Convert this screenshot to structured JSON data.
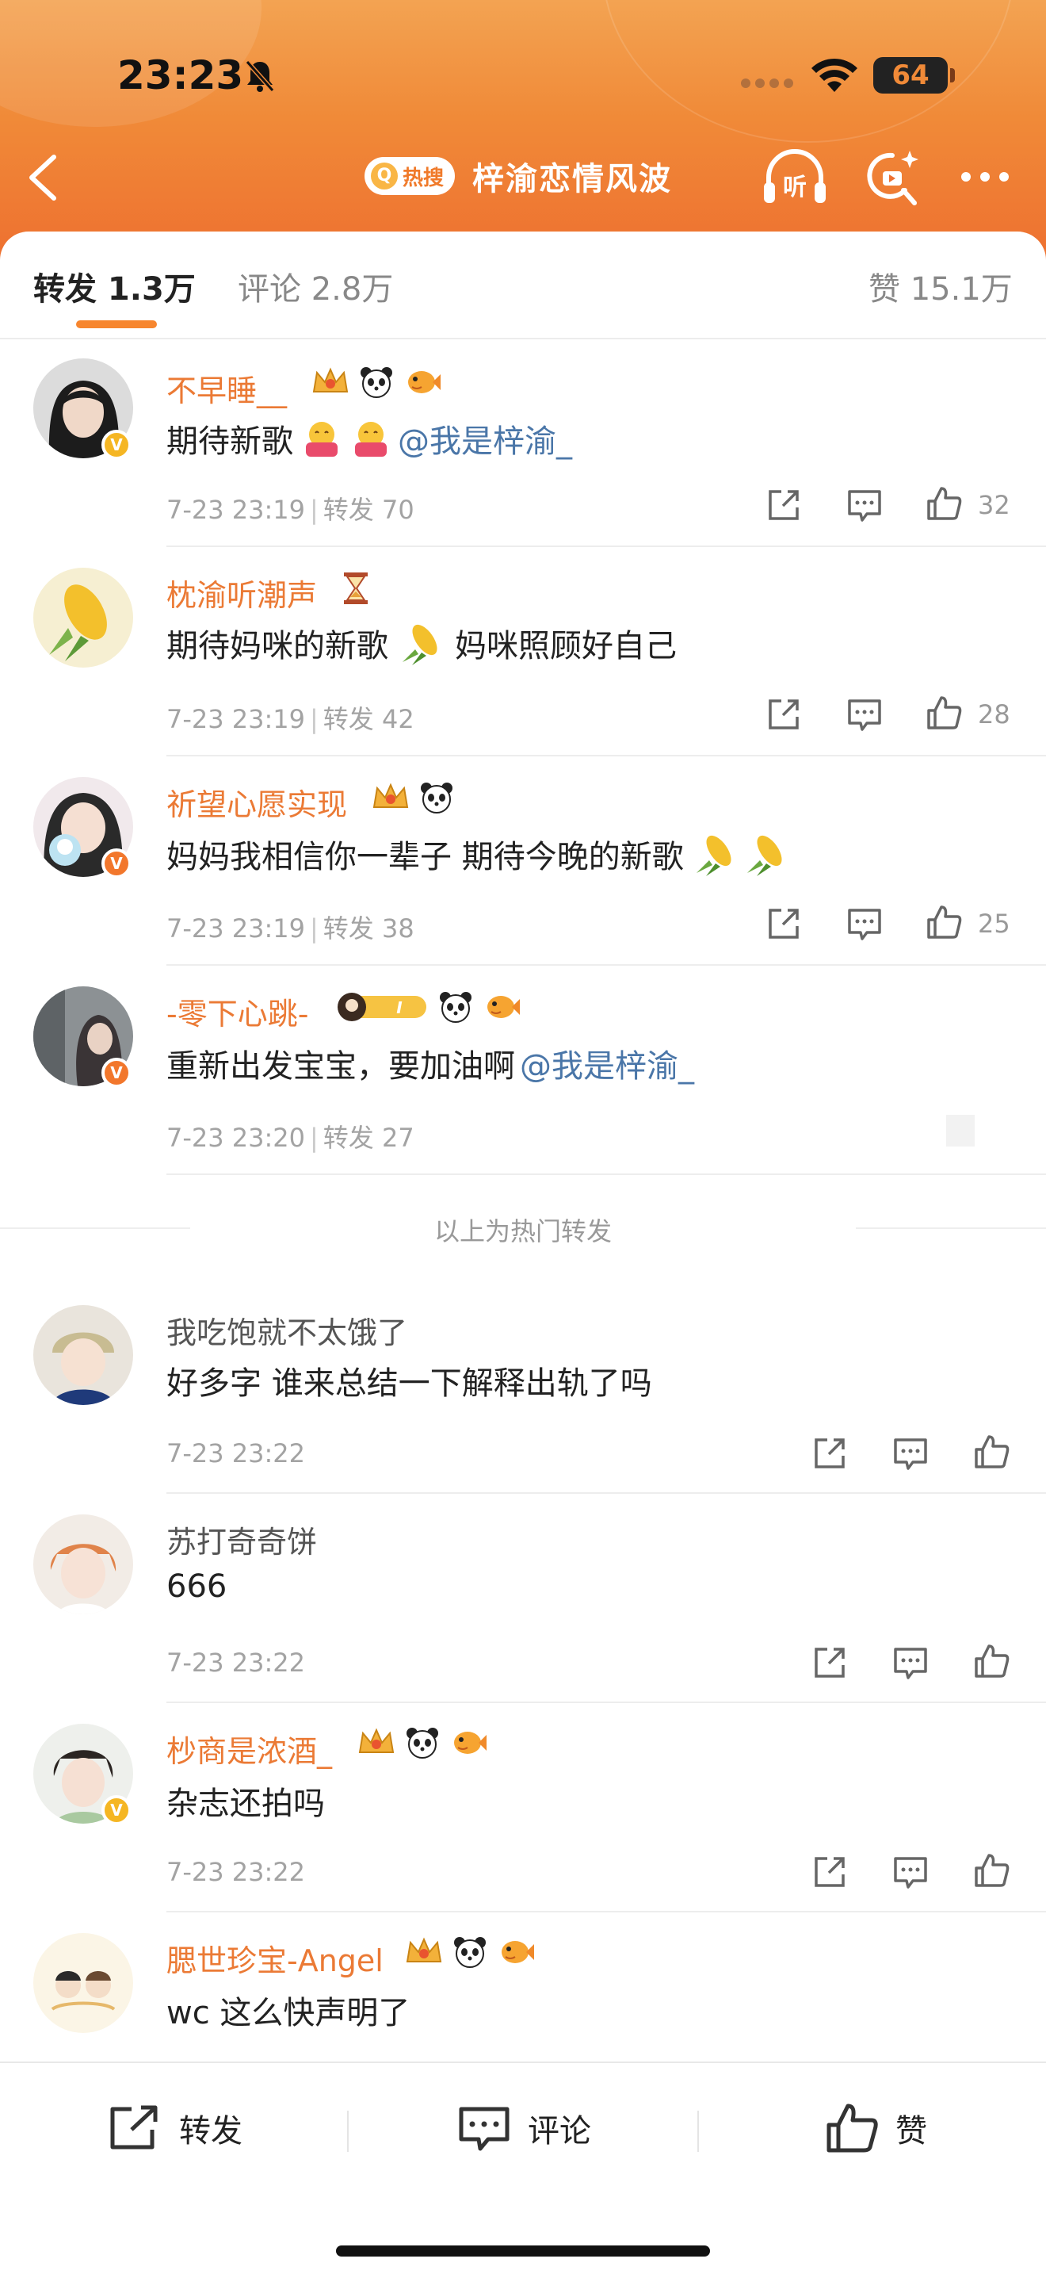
{
  "status_bar": {
    "time": "23:23",
    "battery": "64"
  },
  "header": {
    "hot_badge": "热搜",
    "title": "梓渝恋情风波"
  },
  "tabs": [
    {
      "label": "转发 1.3万",
      "active": true
    },
    {
      "label": "评论 2.8万",
      "active": false
    },
    {
      "label": "赞 15.1万",
      "active": false
    }
  ],
  "hot_reposts": [
    {
      "username": "不早睡__",
      "text": "期待新歌",
      "mention": "@我是梓渝_",
      "date": "7-23 23:19",
      "repost_label": "转发",
      "reposts": "70",
      "likes": "32"
    },
    {
      "username": "枕渝听潮声",
      "text": "期待妈咪的新歌",
      "text2": "妈咪照顾好自己",
      "date": "7-23 23:19",
      "repost_label": "转发",
      "reposts": "42",
      "likes": "28"
    },
    {
      "username": "祈望心愿实现",
      "text": "妈妈我相信你一辈子 期待今晚的新歌",
      "date": "7-23 23:19",
      "repost_label": "转发",
      "reposts": "38",
      "likes": "25"
    },
    {
      "username": "-零下心跳-",
      "text": "重新出发宝宝，要加油啊",
      "mention": "@我是梓渝_",
      "date": "7-23 23:20",
      "repost_label": "转发",
      "reposts": "27"
    }
  ],
  "hot_separator": "以上为热门转发",
  "reposts": [
    {
      "username": "我吃饱就不太饿了",
      "text": "好多字 谁来总结一下解释出轨了吗",
      "date": "7-23 23:22"
    },
    {
      "username": "苏打奇奇饼",
      "text": "666",
      "date": "7-23 23:22"
    },
    {
      "username": "杪商是浓酒_",
      "text": "杂志还拍吗",
      "date": "7-23 23:22"
    },
    {
      "username": "腮世珍宝-Angel",
      "text": "wc 这么快声明了"
    }
  ],
  "bottom_bar": {
    "repost": "转发",
    "comment": "评论",
    "like": "赞"
  },
  "colors": {
    "accent": "#f7862e",
    "username": "#eb7a35",
    "mention": "#4a76a8"
  }
}
